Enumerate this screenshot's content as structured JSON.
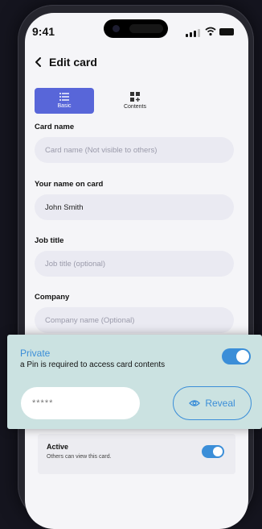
{
  "status": {
    "time": "9:41"
  },
  "header": {
    "title": "Edit card",
    "back_icon": "chevron-left-icon"
  },
  "tabs": [
    {
      "label": "Basic",
      "icon": "list-icon",
      "selected": true
    },
    {
      "label": "Contents",
      "icon": "grid-plus-icon",
      "selected": false
    }
  ],
  "form": {
    "card_name": {
      "label": "Card name",
      "value": "",
      "placeholder": "Card name (Not visible to others)"
    },
    "your_name": {
      "label": "Your name on card",
      "value": "John Smith",
      "placeholder": ""
    },
    "job_title": {
      "label": "Job title",
      "value": "",
      "placeholder": "Job title (optional)"
    },
    "company": {
      "label": "Company",
      "value": "",
      "placeholder": "Company name (Optional)"
    }
  },
  "active": {
    "title": "Active",
    "subtitle": "Others can view this card.",
    "enabled": true
  },
  "private": {
    "title": "Private",
    "subtitle": "a Pin is required to access card contents",
    "enabled": true,
    "pin_masked": "*****",
    "reveal_label": "Reveal"
  },
  "colors": {
    "accent": "#3b8ed8",
    "tab_active": "#5866d9",
    "overlay_bg": "#cbe2e1",
    "field_bg": "#eaeaf2"
  }
}
